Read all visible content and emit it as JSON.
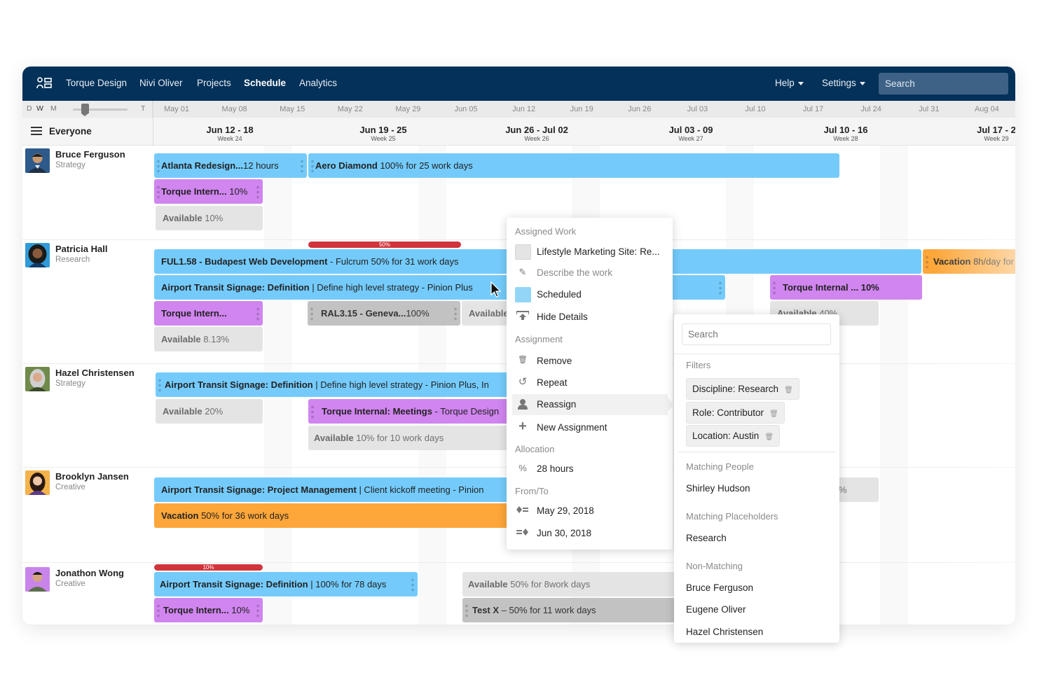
{
  "nav": {
    "logo_icon": "people-board-icon",
    "links": [
      "Torque Design",
      "Nivi Oliver",
      "Projects",
      "Schedule",
      "Analytics"
    ],
    "active": "Schedule",
    "help": "Help",
    "settings": "Settings",
    "search_placeholder": "Search"
  },
  "zoom_control": {
    "options": [
      "D",
      "W",
      "M"
    ],
    "selected": "W",
    "end_label": "T"
  },
  "ruler_dates": [
    "May 01",
    "May 08",
    "May 15",
    "May 22",
    "May 29",
    "Jun 05",
    "Jun 12",
    "Jun 19",
    "Jun 26",
    "Jul 03",
    "Jul 10",
    "Jul 17",
    "Jul 24",
    "Jul 31",
    "Aug 04"
  ],
  "filter_label": "Everyone",
  "weeks": [
    {
      "range": "Jun 12 - 18",
      "week": "Week 24"
    },
    {
      "range": "Jun 19 - 25",
      "week": "Week 25"
    },
    {
      "range": "Jun 26 - Jul 02",
      "week": "Week 26"
    },
    {
      "range": "Jul 03 - 09",
      "week": "Week 27"
    },
    {
      "range": "Jul 10 - 16",
      "week": "Week 28"
    },
    {
      "range": "Jul 17 - 2",
      "week": "Week 29"
    }
  ],
  "people": [
    {
      "name": "Bruce Ferguson",
      "role": "Strategy",
      "bars": [
        {
          "bold": "Atlanta Redesign...",
          "text": "12 hours",
          "color": "blue"
        },
        {
          "bold": "Aero Diamond",
          "text": " 100% for 25 work days",
          "color": "blue"
        },
        {
          "bold": "Torque Intern...",
          "text": " 10%",
          "color": "purple"
        },
        {
          "bold": "Available",
          "text": " 10%",
          "color": "grey"
        }
      ]
    },
    {
      "name": "Patricia Hall",
      "role": "Research",
      "overallocation": "50%",
      "bars": [
        {
          "bold": "FUL1.58 - Budapest Web Development",
          "text": "  - Fulcrum 50% for 31 work days",
          "color": "blue"
        },
        {
          "bold": "Vacation",
          "text": " 8h/day for",
          "color": "orange"
        },
        {
          "bold": "Airport Transit Signage: Definition",
          "text": " |  Define high level strategy - Pinion Plus",
          "color": "blue"
        },
        {
          "bold": "Torque Internal ... 10%",
          "text": "",
          "color": "purple"
        },
        {
          "bold": "Torque Intern...",
          "text": "",
          "color": "purple"
        },
        {
          "bold": "RAL3.15  - Geneva...",
          "text": "100%",
          "color": "dgrey"
        },
        {
          "bold": "Available",
          "text": "",
          "color": "grey"
        },
        {
          "bold": "Available",
          "text": " 40%",
          "color": "grey"
        },
        {
          "bold": "Available",
          "text": " 8.13%",
          "color": "grey"
        }
      ]
    },
    {
      "name": "Hazel Christensen",
      "role": "Strategy",
      "bars": [
        {
          "bold": "Airport Transit Signage: Definition",
          "text": " | Define high level strategy - Pinion Plus, In",
          "color": "blue"
        },
        {
          "bold": "Available",
          "text": "  20%",
          "color": "grey"
        },
        {
          "bold": "Torque Internal: Meetings",
          "text": " - Torque Design",
          "color": "purple"
        },
        {
          "bold": "Available",
          "text": "  10% for 10 work days",
          "color": "grey"
        }
      ]
    },
    {
      "name": "Brooklyn Jansen",
      "role": "Creative",
      "bars": [
        {
          "bold": "Airport Transit Signage: Project Management",
          "text": "   |  Client kickoff meeting - Pinion",
          "color": "blue"
        },
        {
          "bold": "Vacation",
          "text": " 50% for 36 work days",
          "color": "orange"
        },
        {
          "bold": "",
          "text": "%",
          "color": "grey"
        }
      ]
    },
    {
      "name": "Jonathon Wong",
      "role": "Creative",
      "overallocation": "10%",
      "bars": [
        {
          "bold": "Airport Transit Signage: Definition",
          "text": " | 100% for 78 days",
          "color": "blue"
        },
        {
          "bold": "Torque Intern...",
          "text": " 10%",
          "color": "purple"
        },
        {
          "bold": "Available",
          "text": " 50% for  8work days",
          "color": "grey"
        },
        {
          "bold": "Test X",
          "text": "  – 50% for 11 work days",
          "color": "dgrey"
        }
      ]
    }
  ],
  "context_menu": {
    "sections": {
      "assigned_work": "Assigned Work",
      "assignment": "Assignment",
      "allocation": "Allocation",
      "from_to": "From/To"
    },
    "project": "Lifestyle Marketing Site: Re...",
    "describe_placeholder": "Describe the work",
    "status": "Scheduled",
    "status_color": "#93d5f7",
    "hide_details": "Hide Details",
    "remove": "Remove",
    "repeat": "Repeat",
    "reassign": "Reassign",
    "new_assignment": "New Assignment",
    "allocation_value": "28 hours",
    "from_date": "May 29, 2018",
    "to_date": "Jun 30, 2018"
  },
  "reassign_panel": {
    "search_placeholder": "Search",
    "filters_label": "Filters",
    "filters": [
      "Discipline: Research",
      "Role: Contributor",
      "Location: Austin"
    ],
    "matching_people_label": "Matching People",
    "matching_people": [
      "Shirley Hudson"
    ],
    "matching_placeholders_label": "Matching Placeholders",
    "matching_placeholders": [
      "Research"
    ],
    "non_matching_label": "Non-Matching",
    "non_matching": [
      "Bruce Ferguson",
      "Eugene Oliver",
      "Hazel Christensen"
    ]
  },
  "colors": {
    "nav_bg": "#043159",
    "project_blue": "#74cbfb",
    "internal_purple": "#d085ef",
    "vacation_orange": "#fda63a",
    "available_grey": "#e4e4e4",
    "overallocation_red": "#d1343b"
  }
}
